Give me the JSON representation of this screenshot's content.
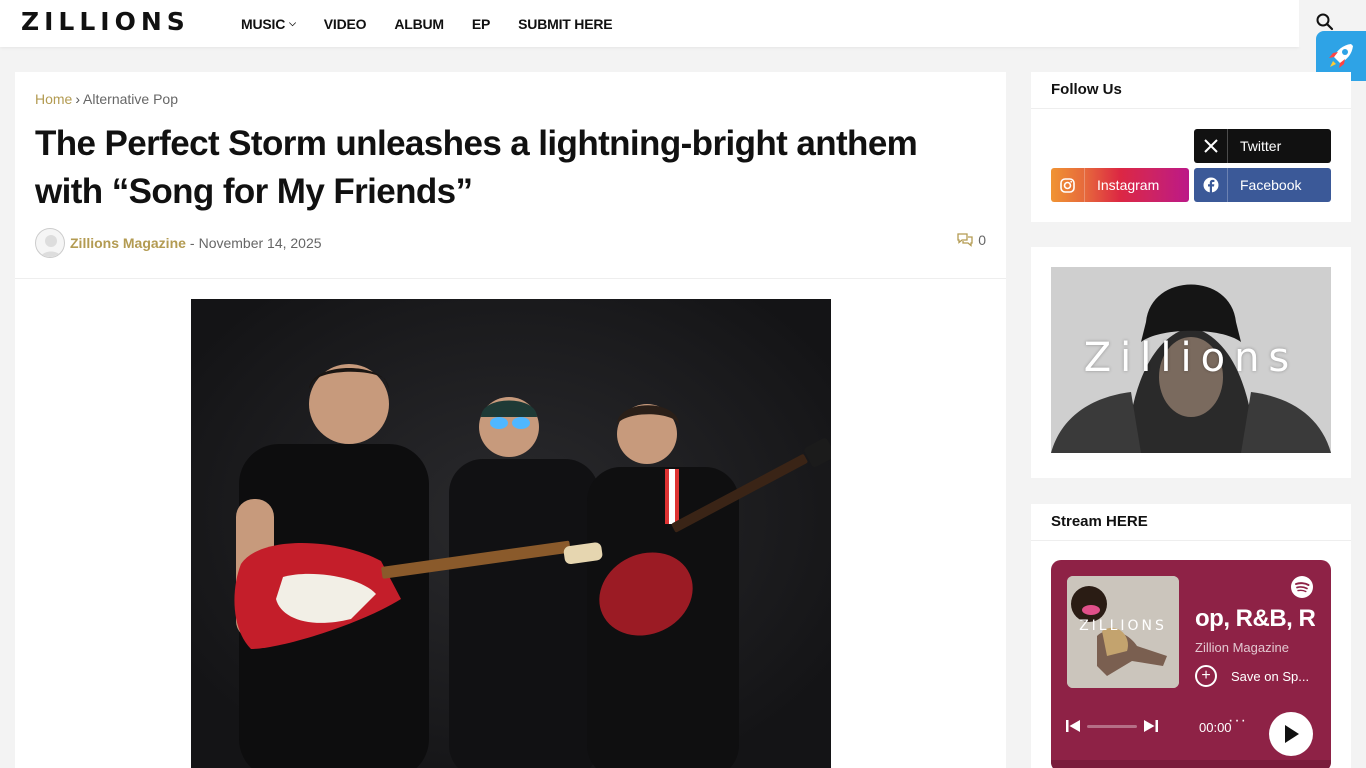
{
  "header": {
    "logo": "ZILLIONS",
    "nav": [
      {
        "label": "MUSIC",
        "has_dropdown": true
      },
      {
        "label": "VIDEO"
      },
      {
        "label": "ALBUM"
      },
      {
        "label": "EP"
      },
      {
        "label": "SUBMIT HERE"
      }
    ],
    "search_icon": "search-icon",
    "rocket_icon": "rocket-icon"
  },
  "article": {
    "breadcrumb": {
      "home": "Home",
      "separator": "›",
      "category": "Alternative Pop"
    },
    "title": "The Perfect Storm unleashes a lightning-bright anthem with “Song for My Friends”",
    "author": "Zillions Magazine",
    "dash": "-",
    "date": "November 14, 2025",
    "comment_count": "0"
  },
  "sidebar": {
    "follow": {
      "title": "Follow Us",
      "twitter": "Twitter",
      "instagram": "Instagram",
      "facebook": "Facebook"
    },
    "banner_text": "Zillions",
    "stream": {
      "title": "Stream HERE",
      "cover_text": "ZILLIONS",
      "track_title": "op, R&B, Ro",
      "artist": "Zillion Magazine",
      "save_label": "Save on Sp...",
      "time": "00:00",
      "more": "···"
    }
  },
  "colors": {
    "accent": "#b39b52",
    "spotify_bg": "#8e2246",
    "rocket_bg": "#2ea3e6"
  }
}
